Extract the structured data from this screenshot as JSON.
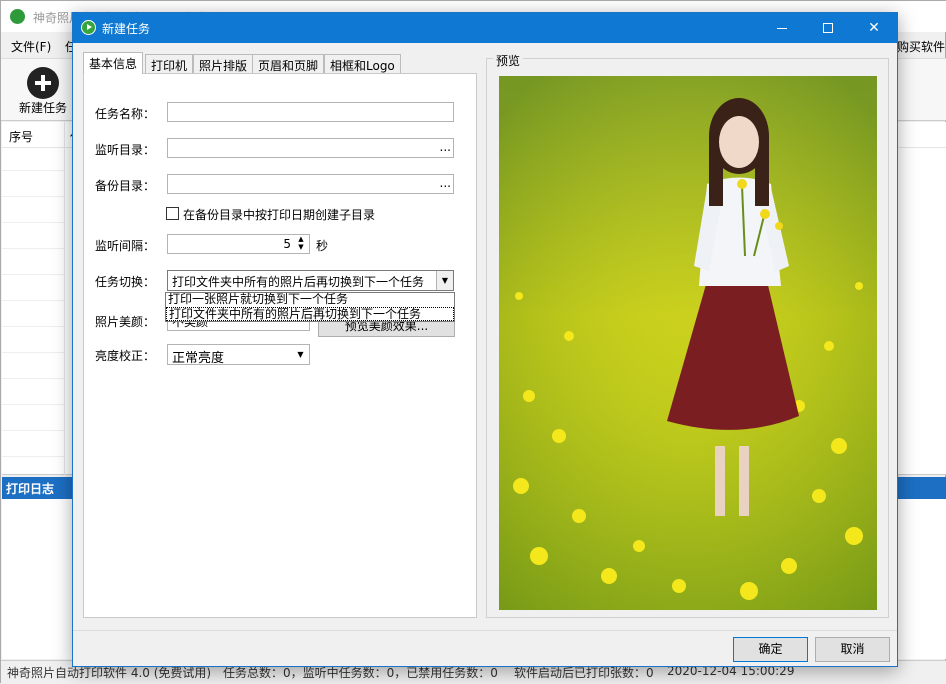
{
  "main_window": {
    "title": "神奇照片自动打印软件 4.0 (免费试用)",
    "menu": [
      "文件(F)",
      "任"
    ],
    "buy_link": "购买软件",
    "toolbar": {
      "new_task_label": "新建任务"
    },
    "list_columns": [
      "序号",
      "任"
    ],
    "log_title": "打印日志",
    "status": {
      "app_version": "神奇照片自动打印软件 4.0 (免费试用)",
      "counts": "任务总数：0，监听中任务数：0，已禁用任务数：0",
      "printed": "软件启动后已打印张数：0",
      "timestamp": "2020-12-04 15:00:29"
    }
  },
  "dialog": {
    "title": "新建任务",
    "tabs": [
      "基本信息",
      "打印机",
      "照片排版",
      "页眉和页脚",
      "相框和Logo"
    ],
    "active_tab": "基本信息",
    "form": {
      "task_name_label": "任务名称：",
      "task_name_value": "",
      "watch_dir_label": "监听目录：",
      "watch_dir_value": "",
      "backup_dir_label": "备份目录：",
      "backup_dir_value": "",
      "browse_label": "...",
      "subdir_checkbox_label": "在备份目录中按打印日期创建子目录",
      "subdir_checked": false,
      "interval_label": "监听间隔：",
      "interval_value": "5",
      "interval_unit": "秒",
      "switch_label": "任务切换：",
      "switch_value": "打印文件夹中所有的照片后再切换到下一个任务",
      "switch_options": [
        "打印一张照片就切换到下一个任务",
        "打印文件夹中所有的照片后再切换到下一个任务"
      ],
      "beauty_label": "照片美颜：",
      "beauty_value": "不美颜",
      "beauty_button": "预览美颜效果...",
      "brightness_label": "亮度校正：",
      "brightness_value": "正常亮度"
    },
    "preview_label": "预览",
    "ok_button": "确定",
    "cancel_button": "取消"
  },
  "colors": {
    "title_blue": "#0f78d2",
    "log_header_blue": "#1c6fc3",
    "photo_field": "#c7d62a",
    "dress": "#7a1e22"
  }
}
